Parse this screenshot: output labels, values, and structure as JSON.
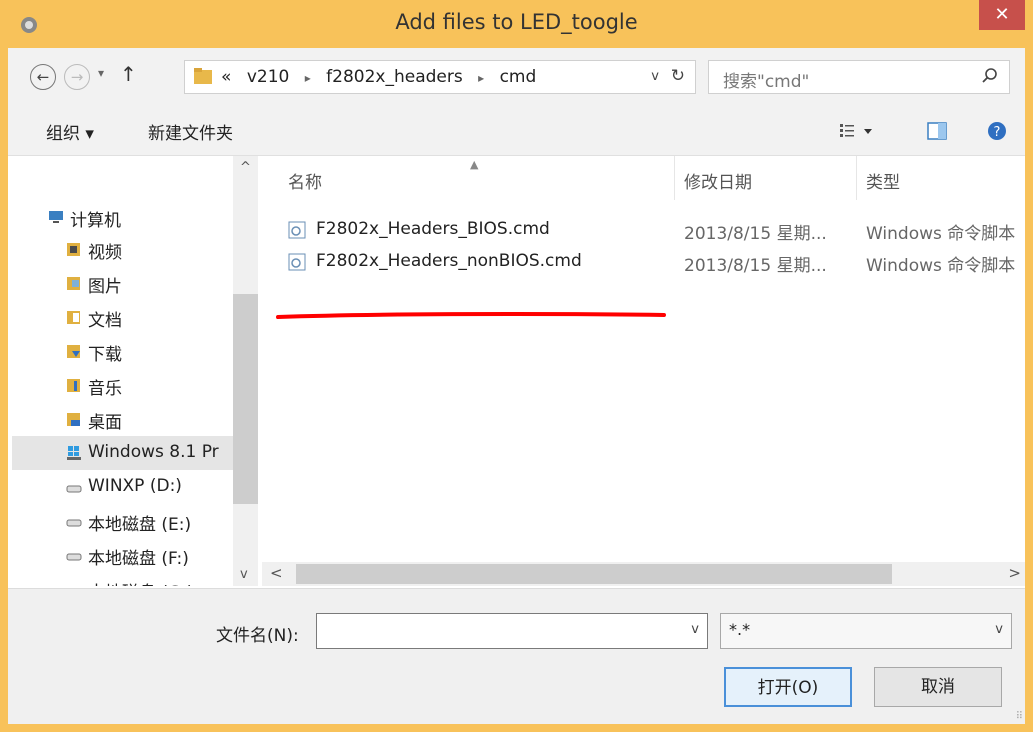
{
  "window": {
    "title": "Add files to LED_toogle",
    "close_glyph": "✕"
  },
  "nav": {
    "back_glyph": "←",
    "forward_glyph": "→",
    "recent_glyph": "▾",
    "up_glyph": "↑",
    "breadcrumb": [
      "«",
      "v210",
      "f2802x_headers",
      "cmd"
    ],
    "crumb_sep": "▸",
    "dropdown_glyph": "v",
    "refresh_glyph": "↻",
    "search_placeholder": "搜索\"cmd\""
  },
  "toolbar": {
    "organize": "组织 ▾",
    "new_folder": "新建文件夹",
    "views_caret": "▾"
  },
  "sidebar": {
    "items": [
      {
        "label": "计算机",
        "icon": "computer-icon"
      },
      {
        "label": "视频",
        "icon": "video-library-icon"
      },
      {
        "label": "图片",
        "icon": "pictures-library-icon"
      },
      {
        "label": "文档",
        "icon": "documents-library-icon"
      },
      {
        "label": "下载",
        "icon": "downloads-library-icon"
      },
      {
        "label": "音乐",
        "icon": "music-library-icon"
      },
      {
        "label": "桌面",
        "icon": "desktop-icon"
      },
      {
        "label": "Windows 8.1 Pr",
        "icon": "windows-drive-icon"
      },
      {
        "label": "WINXP (D:)",
        "icon": "drive-icon"
      },
      {
        "label": "本地磁盘 (E:)",
        "icon": "drive-icon"
      },
      {
        "label": "本地磁盘 (F:)",
        "icon": "drive-icon"
      },
      {
        "label": "本地磁盘 (G:)",
        "icon": "drive-icon"
      }
    ],
    "scroll_up": "^",
    "scroll_down": "v"
  },
  "files": {
    "columns": {
      "name": "名称",
      "date": "修改日期",
      "type": "类型"
    },
    "rows": [
      {
        "name": "F2802x_Headers_BIOS.cmd",
        "date": "2013/8/15 星期...",
        "type": "Windows 命令脚本"
      },
      {
        "name": "F2802x_Headers_nonBIOS.cmd",
        "date": "2013/8/15 星期...",
        "type": "Windows 命令脚本"
      }
    ],
    "hscroll_left": "<",
    "hscroll_right": ">"
  },
  "bottom": {
    "filename_label": "文件名(N):",
    "filename_value": "",
    "dropdown_glyph": "v",
    "filter_value": "*.*",
    "open_button": "打开(O)",
    "cancel_button": "取消"
  },
  "colors": {
    "titlebar": "#f8c25a",
    "close": "#c7504b",
    "annotation": "#ff0000"
  }
}
